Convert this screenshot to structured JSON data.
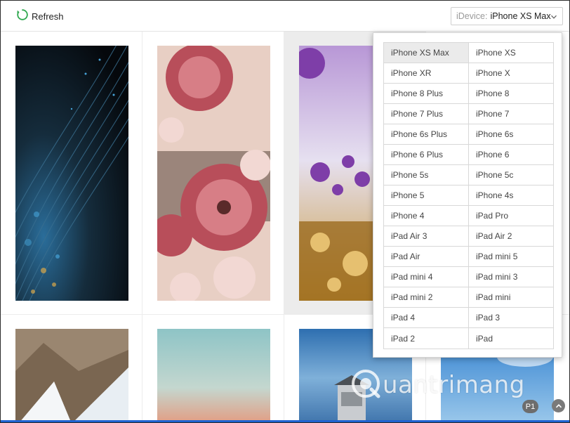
{
  "toolbar": {
    "refresh_label": "Refresh",
    "refresh_icon": "refresh-icon",
    "accent_color": "#2fa84f"
  },
  "device_select": {
    "key_label": "iDevice:",
    "value": "iPhone XS Max",
    "icon": "chevron-down-icon"
  },
  "device_options": [
    "iPhone XS Max",
    "iPhone XS",
    "iPhone XR",
    "iPhone X",
    "iPhone 8 Plus",
    "iPhone 8",
    "iPhone 7 Plus",
    "iPhone 7",
    "iPhone 6s Plus",
    "iPhone 6s",
    "iPhone 6 Plus",
    "iPhone 6",
    "iPhone 5s",
    "iPhone 5c",
    "iPhone 5",
    "iPhone 4s",
    "iPhone 4",
    "iPad Pro",
    "iPad Air 3",
    "iPad Air 2",
    "iPad Air",
    "iPad mini 5",
    "iPad mini 4",
    "iPad mini 3",
    "iPad mini 2",
    "iPad mini",
    "iPad 4",
    "iPad 3",
    "iPad 2",
    "iPad"
  ],
  "selected_option": "iPhone XS Max",
  "wallpapers": [
    {
      "name": "wallpaper-blue-light-streaks"
    },
    {
      "name": "wallpaper-pink-dahlias"
    },
    {
      "name": "wallpaper-purple-flowers",
      "selected": true
    },
    {
      "name": "wallpaper-hidden"
    },
    {
      "name": "wallpaper-rock-arch"
    },
    {
      "name": "wallpaper-pastel-sky"
    },
    {
      "name": "wallpaper-lighthouse"
    },
    {
      "name": "wallpaper-blue-sky"
    }
  ],
  "watermark": "uantrimang",
  "pagination": {
    "page_label": "P1",
    "back_to_top_icon": "chevron-up-icon"
  },
  "colors": {
    "bottom_bar": "#1e62d0",
    "selected_cell": "#ececec"
  }
}
